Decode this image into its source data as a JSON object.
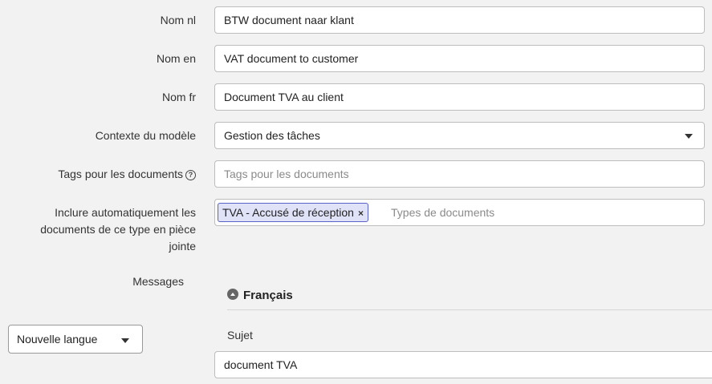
{
  "form": {
    "nom_nl": {
      "label": "Nom nl",
      "value": "BTW document naar klant"
    },
    "nom_en": {
      "label": "Nom en",
      "value": "VAT document to customer"
    },
    "nom_fr": {
      "label": "Nom fr",
      "value": "Document TVA au client"
    },
    "contexte": {
      "label": "Contexte du modèle",
      "value": "Gestion des tâches"
    },
    "tags": {
      "label": "Tags pour les documents",
      "placeholder": "Tags pour les documents"
    },
    "inclure": {
      "label_lines": [
        "Inclure automatiquement les",
        "documents de ce type en pièce",
        "jointe"
      ],
      "tag": "TVA - Accusé de réception",
      "tag_remove": "×",
      "placeholder": "Types de documents"
    },
    "messages": {
      "label": "Messages"
    }
  },
  "messages": {
    "section_title": "Français",
    "subject_label": "Sujet",
    "subject_value": "document TVA"
  },
  "language_select": {
    "value": "Nouvelle langue"
  },
  "icons": {
    "help": "?",
    "help_icon": "question-circle-icon",
    "collapse_icon": "chevron-up-circle-icon",
    "dropdown_icon": "caret-down-icon"
  },
  "colors": {
    "background": "#f2f2f2",
    "tag_background": "#e0e2f8",
    "tag_border": "#5a62c8"
  }
}
